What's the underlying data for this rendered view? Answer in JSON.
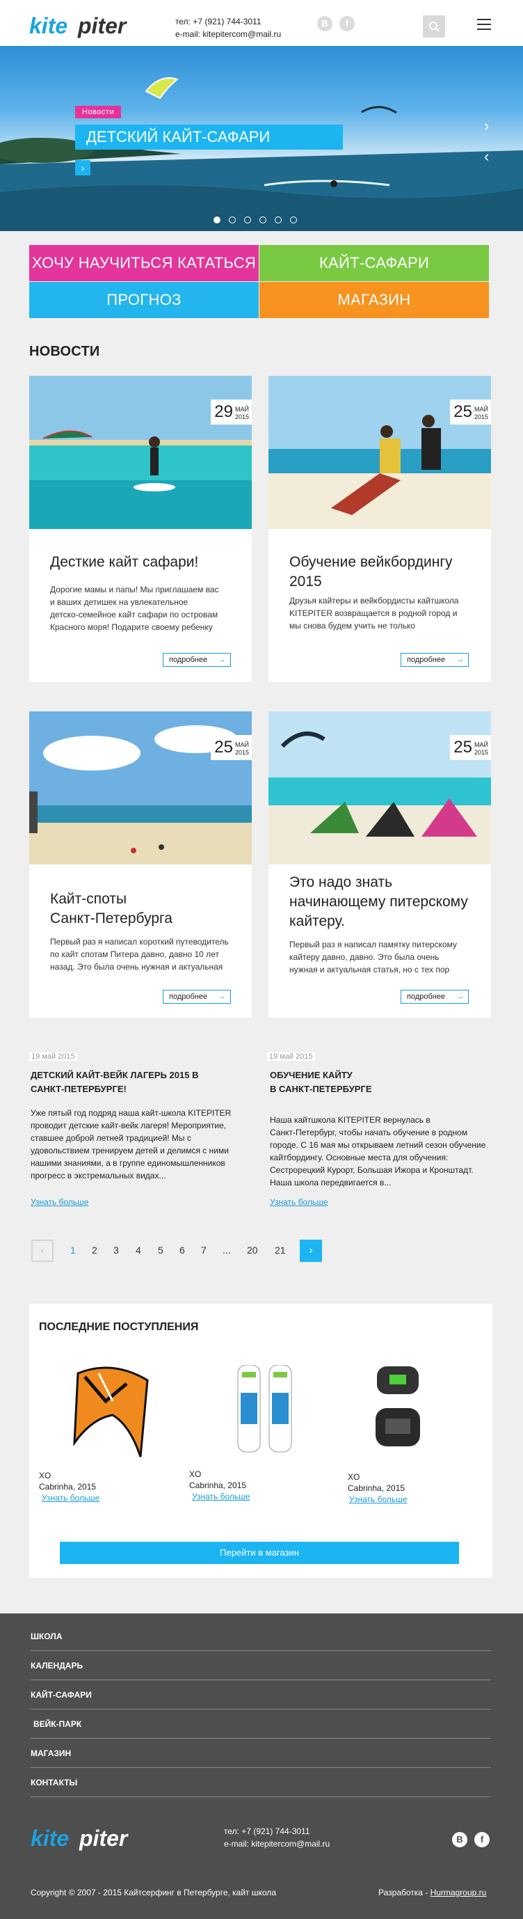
{
  "header": {
    "logo_text": "kitepiter",
    "phone": "тел: +7 (921) 744-3011",
    "email": "e-mail: kitepitercom@mail.ru",
    "social": [
      "В",
      "f"
    ]
  },
  "hero": {
    "tag": "Новости",
    "title": "ДЕТСКИЙ КАЙТ-САФАРИ",
    "button": "›",
    "slides_total": 6,
    "active_slide": 1
  },
  "tiles": [
    {
      "label": "ХОЧУ НАУЧИТЬСЯ КАТАТЬСЯ",
      "color": "#e3359b"
    },
    {
      "label": "КАЙТ-САФАРИ",
      "color": "#7ac943"
    },
    {
      "label": "ПРОГНОЗ",
      "color": "#23b6ee"
    },
    {
      "label": "МАГАЗИН",
      "color": "#f7931e"
    }
  ],
  "news": {
    "heading": "НОВОСТИ",
    "more_label": "подробнее",
    "cards": [
      {
        "day": "29",
        "month": "МАЙ",
        "year": "2015",
        "title_lines": [
          "Десткие кайт сафари!"
        ],
        "text_lines": [
          "Дорогие мамы и папы! Мы приглашаем вас",
          "и ваших детишек на увлекательное",
          "детско-семейное кайт сафари по островам",
          "Красного моря! Подарите своему ребенку"
        ]
      },
      {
        "day": "25",
        "month": "МАЙ",
        "year": "2015",
        "title_lines": [
          "Обучение вейкбордингу",
          "2015"
        ],
        "text_lines": [
          "Друзья кайтеры и вейкбордисты кайтшкола",
          "KITEPITER возвращается в родной город и",
          "мы снова будем учить не только"
        ]
      },
      {
        "day": "25",
        "month": "МАЙ",
        "year": "2015",
        "title_lines": [
          "Кайт-споты",
          "Санкт-Петербурга"
        ],
        "text_lines": [
          "Первый раз я написал короткий путеводитель",
          "по кайт спотам Питера давно, давно 10 лет",
          "назад. Это была очень нужная и актуальная"
        ]
      },
      {
        "day": "25",
        "month": "МАЙ",
        "year": "2015",
        "title_lines": [
          "Это надо знать",
          "начинающему питерскому",
          "кайтеру."
        ],
        "text_lines": [
          "Первый раз я написал памятку питерскому",
          "кайтеру давно, давно. Это была очень",
          "нужная и актуальная статья, но с тех пор"
        ]
      }
    ]
  },
  "short_news": [
    {
      "date": "19 май 2015",
      "title_lines": [
        "ДЕТСКИЙ КАЙТ-ВЕЙК ЛАГЕРЬ 2015 В",
        "САНКТ-ПЕТЕРБУРГЕ!"
      ],
      "text_lines": [
        "Уже пятый год подряд наша кайт-школа KITEPITER",
        "проводит детские кайт-вейк лагеря! Мероприятие,",
        "ставшее доброй летней традицией! Мы с",
        "удовольствием тренируем детей и делимся с ними",
        "нашими знаниями, а в группе единомышленников",
        "прогресс в экстремальных видах..."
      ],
      "link": "Узнать больше"
    },
    {
      "date": "19 май 2015",
      "title_lines": [
        "ОБУЧЕНИЕ КАЙТУ",
        "В САНКТ-ПЕТЕРБУРГЕ"
      ],
      "text_lines": [
        "Наша кайтшкола KITEPITER вернулась в",
        "Санкт-Петербург, чтобы начать обучение в родном",
        "городе. С 16 мая мы открываем летний сезон обучение",
        "кайтбордингу. Основные места для обучения:",
        "Сестрорецкий Курорт, Большая Ижора и Кронштадт.",
        "Наша школа передвигается в..."
      ],
      "link": "Узнать больше"
    }
  ],
  "pagination": {
    "prev": "‹",
    "next": "›",
    "pages": [
      "1",
      "2",
      "3",
      "4",
      "5",
      "6",
      "7",
      "...",
      "20",
      "21"
    ],
    "current": "1"
  },
  "shop": {
    "title": "ПОСЛЕДНИЕ ПОСТУПЛЕНИЯ",
    "products": [
      {
        "name": "XO",
        "sub": "Cabrinha, 2015",
        "link": "Узнать больше"
      },
      {
        "name": "XO",
        "sub": "Cabrinha, 2015",
        "link": "Узнать больше"
      },
      {
        "name": "XO",
        "sub": "Cabrinha, 2015",
        "link": "Узнать больше"
      }
    ],
    "button": "Перейти в магазин"
  },
  "footer": {
    "nav": [
      "ШКОЛА",
      "КАЛЕНДАРЬ",
      "КАЙТ-САФАРИ",
      "ВЕЙК-ПАРК",
      "МАГАЗИН",
      "КОНТАКТЫ"
    ],
    "logo_text": "kitepiter",
    "phone": "тел: +7 (921) 744-3011",
    "email": "e-mail: kitepitercom@mail.ru",
    "social": [
      "В",
      "f"
    ],
    "copyright": "Copyright © 2007 - 2015 Кайтсерфинг в Петербурге, кайт школа",
    "dev_label": "Разработка - ",
    "dev_link": "Hurmagroup.ru"
  }
}
